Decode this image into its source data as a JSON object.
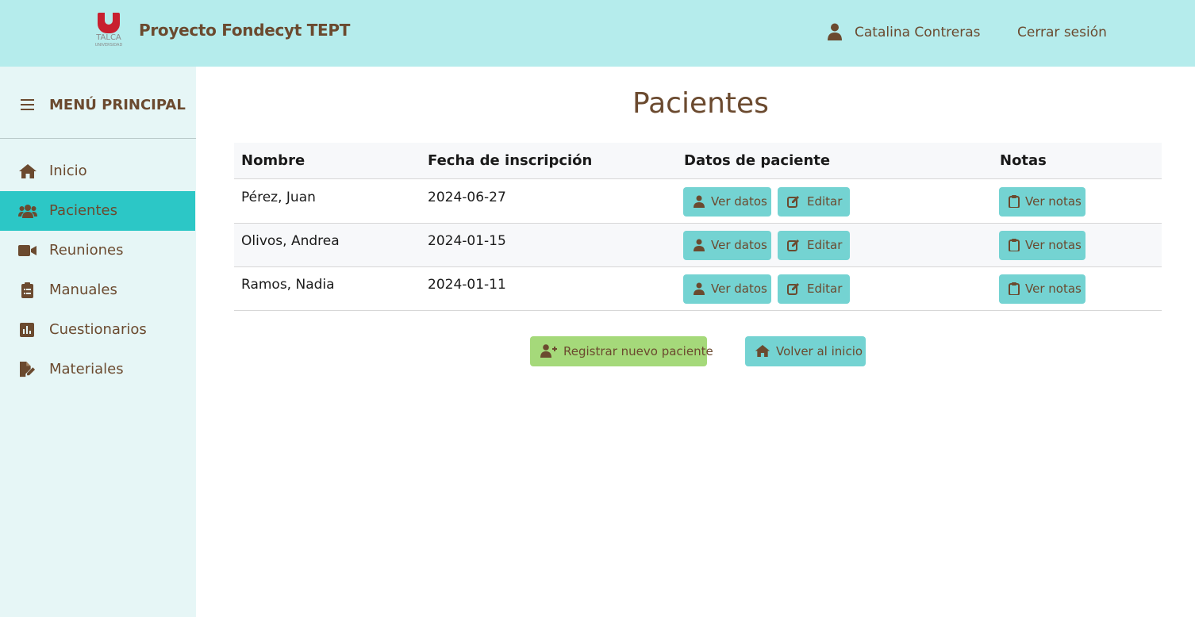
{
  "header": {
    "logo_text": "TALCA",
    "logo_subtext": "UNIVERSIDAD",
    "app_title": "Proyecto Fondecyt TEPT",
    "user_name": "Catalina Contreras",
    "logout_label": "Cerrar sesión"
  },
  "sidebar": {
    "menu_title": "MENÚ PRINCIPAL",
    "items": [
      {
        "label": "Inicio",
        "icon": "home-icon"
      },
      {
        "label": "Pacientes",
        "icon": "users-icon",
        "active": true
      },
      {
        "label": "Reuniones",
        "icon": "video-icon"
      },
      {
        "label": "Manuales",
        "icon": "clipboard-list-icon"
      },
      {
        "label": "Cuestionarios",
        "icon": "chart-icon"
      },
      {
        "label": "Materiales",
        "icon": "file-edit-icon"
      }
    ]
  },
  "main": {
    "title": "Pacientes",
    "table": {
      "headers": [
        "Nombre",
        "Fecha de inscripción",
        "Datos de paciente",
        "Notas"
      ],
      "rows": [
        {
          "name": "Pérez, Juan",
          "date": "2024-06-27"
        },
        {
          "name": "Olivos, Andrea",
          "date": "2024-01-15"
        },
        {
          "name": "Ramos, Nadia",
          "date": "2024-01-11"
        }
      ],
      "view_label": "Ver datos",
      "edit_label": "Editar",
      "notes_label": "Ver notas"
    },
    "register_label": "Registrar nuevo paciente",
    "home_label": "Volver al inicio"
  },
  "colors": {
    "header_bg": "#b5ecec",
    "sidebar_bg": "#e6f6f6",
    "active_item": "#2cc7c6",
    "button_teal": "#74d3d2",
    "button_green": "#a5d97a",
    "text_brown": "#6b4a2f"
  }
}
